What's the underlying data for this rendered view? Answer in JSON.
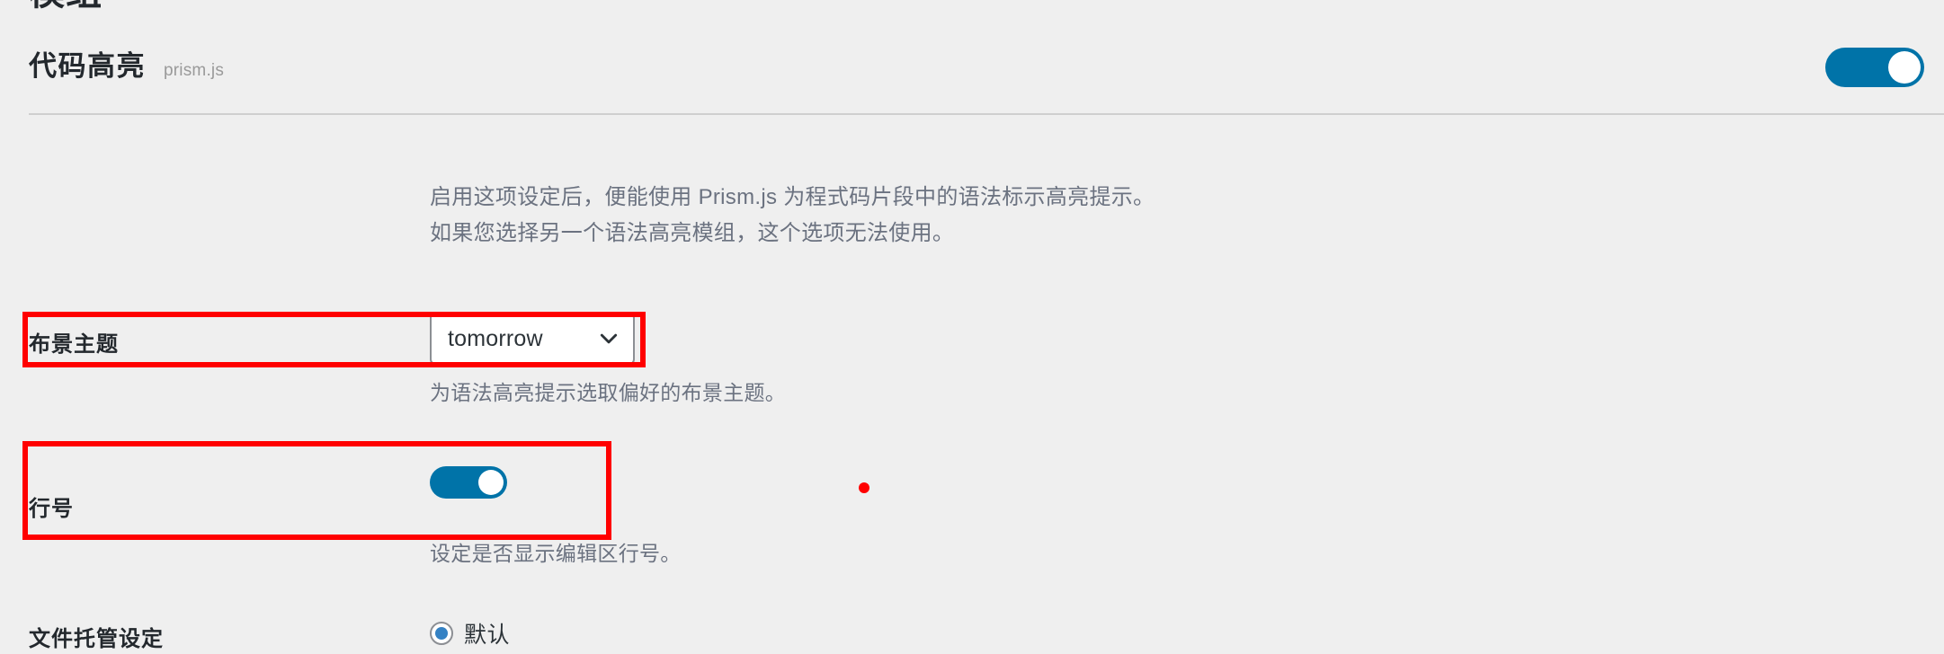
{
  "page": {
    "background_color": "#efefef",
    "clipped_heading": "模组"
  },
  "module_header": {
    "title": "代码高亮",
    "subtitle": "prism.js",
    "enabled_toggle": {
      "name": "code-highlight-enable-toggle",
      "state": "on",
      "accent_color": "#0073a8"
    }
  },
  "description": {
    "line1": "启用这项设定后，便能使用 Prism.js 为程式码片段中的语法标示高亮提示。",
    "line2": "如果您选择另一个语法高亮模组，这个选项无法使用。"
  },
  "settings": {
    "theme": {
      "label": "布景主题",
      "select_value": "tomorrow",
      "options": [
        "tomorrow"
      ],
      "helper": "为语法高亮提示选取偏好的布景主题。",
      "highlighted": true,
      "highlight_color": "#ff0000"
    },
    "line_numbers": {
      "label": "行号",
      "toggle_state": "on",
      "helper": "设定是否显示编辑区行号。",
      "highlighted": true,
      "highlight_color": "#ff0000"
    },
    "file_hosting": {
      "label": "文件托管设定",
      "options": [
        {
          "label": "默认",
          "selected": true
        }
      ]
    }
  },
  "marker": {
    "color": "#ff0000"
  }
}
